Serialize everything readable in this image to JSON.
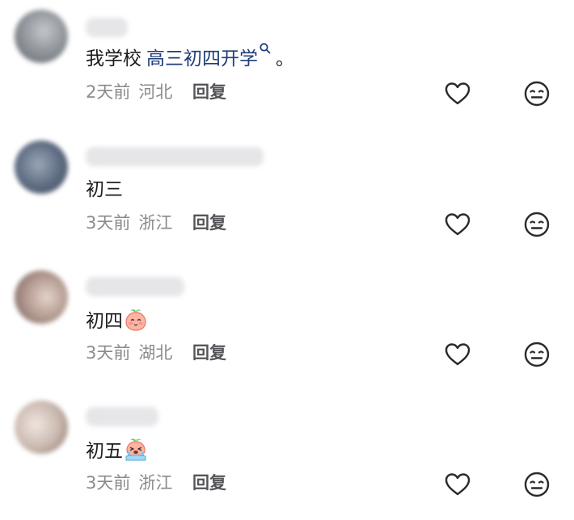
{
  "comments": [
    {
      "text": "我学校",
      "link_text": "高三初四开学",
      "trailing_text": "。",
      "time": "2天前",
      "location": "河北",
      "reply_label": "回复",
      "avatar_color": "#8a8f96"
    },
    {
      "text": "初三",
      "time": "3天前",
      "location": "浙江",
      "reply_label": "回复",
      "avatar_color": "#5c6a80"
    },
    {
      "text": "初四",
      "emoji_icon": "shy-peach-emoji-icon",
      "time": "3天前",
      "location": "湖北",
      "reply_label": "回复",
      "avatar_color": "#b39a90"
    },
    {
      "text": "初五",
      "emoji_icon": "crying-peach-emoji-icon",
      "time": "3天前",
      "location": "浙江",
      "reply_label": "回复",
      "avatar_color": "#c9b7ad"
    }
  ],
  "icons": {
    "like": "heart-outline-icon",
    "dislike": "neutral-face-icon",
    "topic": "search-icon"
  },
  "colors": {
    "text": "#1c1c1e",
    "link": "#1f3d78",
    "meta": "#8a8a8e",
    "icon": "#2a2a2e"
  }
}
